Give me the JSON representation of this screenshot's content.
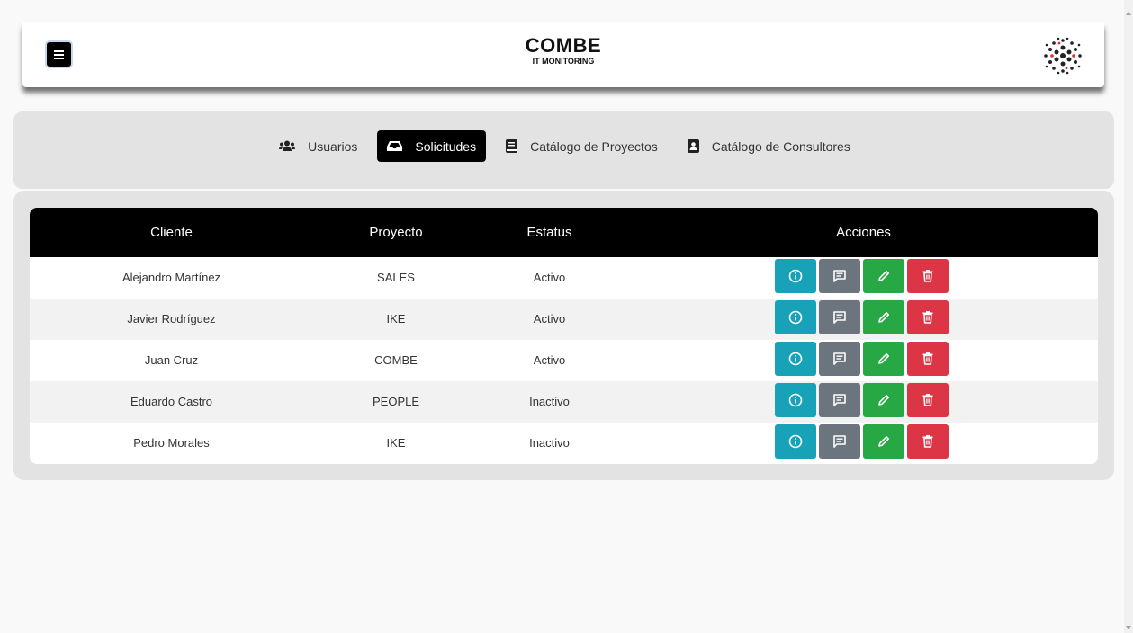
{
  "header": {
    "title": "COMBE",
    "subtitle": "IT MONITORING"
  },
  "nav": {
    "items": [
      {
        "label": "Usuarios",
        "icon": "users-icon",
        "active": false
      },
      {
        "label": "Solicitudes",
        "icon": "inbox-icon",
        "active": true
      },
      {
        "label": "Catálogo de Proyectos",
        "icon": "book-icon",
        "active": false
      },
      {
        "label": "Catálogo de Consultores",
        "icon": "address-book-icon",
        "active": false
      }
    ]
  },
  "table": {
    "headers": [
      "Cliente",
      "Proyecto",
      "Estatus",
      "Acciones"
    ],
    "rows": [
      {
        "cliente": "Alejandro Martínez",
        "proyecto": "SALES",
        "estatus": "Activo"
      },
      {
        "cliente": "Javier Rodríguez",
        "proyecto": "IKE",
        "estatus": "Activo"
      },
      {
        "cliente": "Juan Cruz",
        "proyecto": "COMBE",
        "estatus": "Activo"
      },
      {
        "cliente": "Eduardo Castro",
        "proyecto": "PEOPLE",
        "estatus": "Inactivo"
      },
      {
        "cliente": "Pedro Morales",
        "proyecto": "IKE",
        "estatus": "Inactivo"
      }
    ]
  },
  "colors": {
    "info": "#17a2b8",
    "message": "#6c757d",
    "edit": "#28a745",
    "delete": "#dc3545",
    "active_nav": "#000000"
  }
}
